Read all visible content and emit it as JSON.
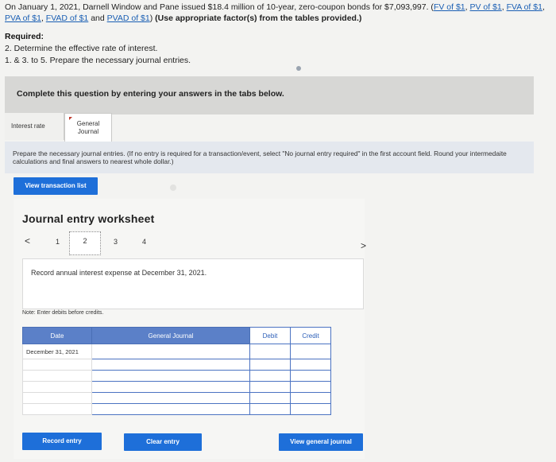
{
  "question": {
    "intro_text": "On January 1, 2021, Darnell Window and Pane issued $18.4 million of 10-year, zero-coupon bonds for $7,093,997.",
    "links": [
      "FV of $1",
      "PV of $1",
      "FVA of $1",
      "PVA of $1",
      "FVAD of $1",
      "PVAD of $1"
    ],
    "link_and": "and",
    "use_tables_note": "(Use appropriate factor(s) from the tables provided.)",
    "required_label": "Required:",
    "required_items": [
      "2. Determine the effective rate of interest.",
      "1. & 3. to 5. Prepare the necessary journal entries."
    ]
  },
  "banner": {
    "text": "Complete this question by entering your answers in the tabs below."
  },
  "tabs": [
    {
      "label": "Interest rate"
    },
    {
      "label_line1": "General",
      "label_line2": "Journal"
    }
  ],
  "instructions": "Prepare the necessary journal entries. (If no entry is required for a transaction/event, select \"No journal entry required\" in the first account field. Round your intermedaite calculations and final answers to nearest whole dollar.)",
  "buttons": {
    "view_transaction_list": "View transaction list",
    "record_entry": "Record entry",
    "clear_entry": "Clear entry",
    "view_general_journal": "View general journal"
  },
  "worksheet": {
    "title": "Journal entry worksheet",
    "prev_arrow": "<",
    "next_arrow": ">",
    "pages": [
      "1",
      "2",
      "3",
      "4"
    ],
    "selected_page": "2",
    "record_text": "Record annual interest expense at December 31, 2021.",
    "note": "Note: Enter debits before credits."
  },
  "journal_table": {
    "headers": {
      "date": "Date",
      "general_journal": "General Journal",
      "debit": "Debit",
      "credit": "Credit"
    },
    "date_value": "December 31, 2021",
    "row_count": 6
  }
}
